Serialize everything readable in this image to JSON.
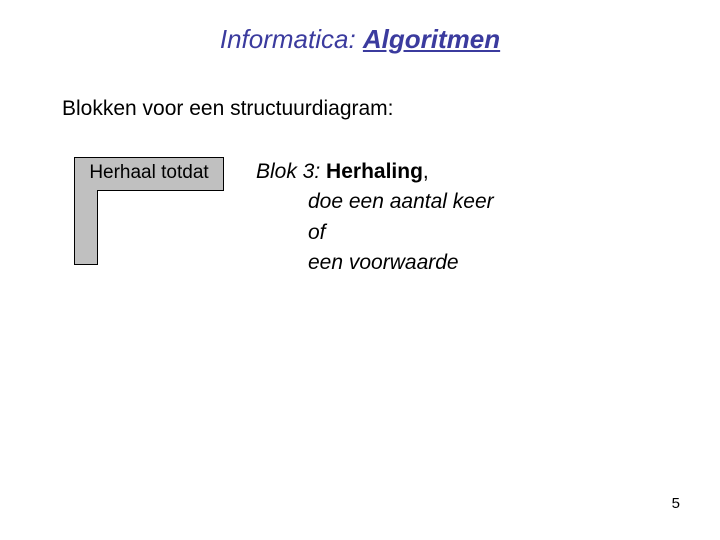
{
  "header": {
    "prefix": "Informatica: ",
    "main": "Algoritmen"
  },
  "subtitle": "Blokken voor een structuurdiagram:",
  "diagram": {
    "label": "Herhaal totdat"
  },
  "description": {
    "heading_prefix": "Blok 3: ",
    "heading_main": "Herhaling",
    "heading_suffix": ",",
    "line1": "doe een aantal keer",
    "line2": "of",
    "line3": "een voorwaarde"
  },
  "page_number": "5"
}
